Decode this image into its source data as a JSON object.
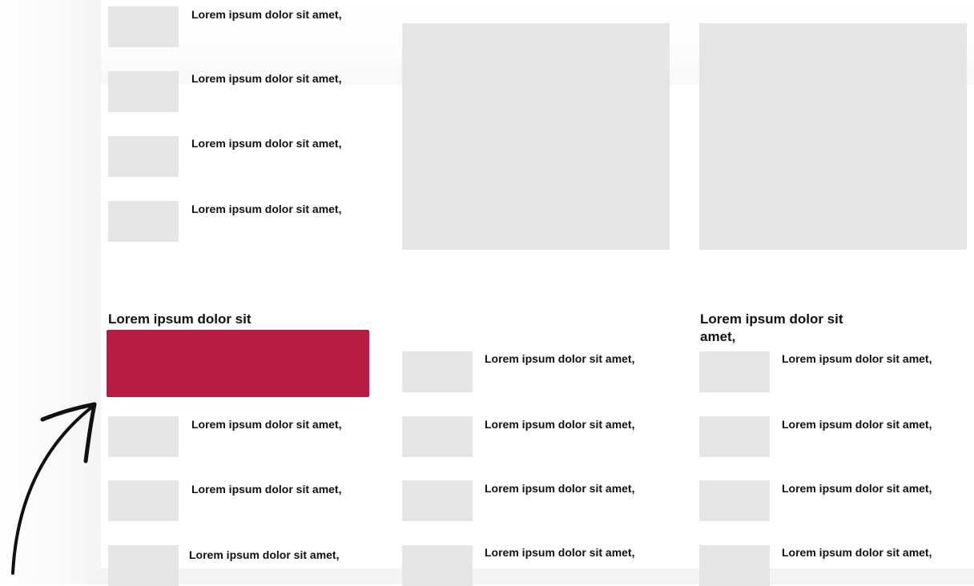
{
  "columns": {
    "left_top": {
      "items": [
        {
          "text": "Lorem ipsum dolor sit amet,"
        },
        {
          "text": "Lorem ipsum dolor sit amet,"
        },
        {
          "text": "Lorem ipsum dolor sit amet,"
        },
        {
          "text": "Lorem ipsum dolor sit amet,"
        }
      ]
    },
    "left_bottom": {
      "heading": "Lorem ipsum dolor sit",
      "items": [
        {
          "text": "Lorem ipsum dolor sit amet,"
        },
        {
          "text": "Lorem ipsum dolor sit amet,"
        },
        {
          "text": "Lorem ipsum dolor sit amet,"
        }
      ]
    },
    "middle_bottom": {
      "items": [
        {
          "text": "Lorem ipsum dolor sit amet,"
        },
        {
          "text": "Lorem ipsum dolor sit amet,"
        },
        {
          "text": "Lorem ipsum dolor sit amet,"
        },
        {
          "text": "Lorem ipsum dolor sit amet,"
        }
      ]
    },
    "right_bottom": {
      "heading_line1": "Lorem ipsum dolor sit",
      "heading_line2": "amet,",
      "items": [
        {
          "text": "Lorem ipsum dolor sit amet,"
        },
        {
          "text": "Lorem ipsum dolor sit amet,"
        },
        {
          "text": "Lorem ipsum dolor sit amet,"
        },
        {
          "text": "Lorem ipsum dolor sit amet,"
        }
      ]
    }
  },
  "colors": {
    "accent": "#b81c43",
    "placeholder": "#e5e5e5",
    "text": "#111111"
  },
  "icons": {
    "arrow": "curved-arrow-icon"
  }
}
